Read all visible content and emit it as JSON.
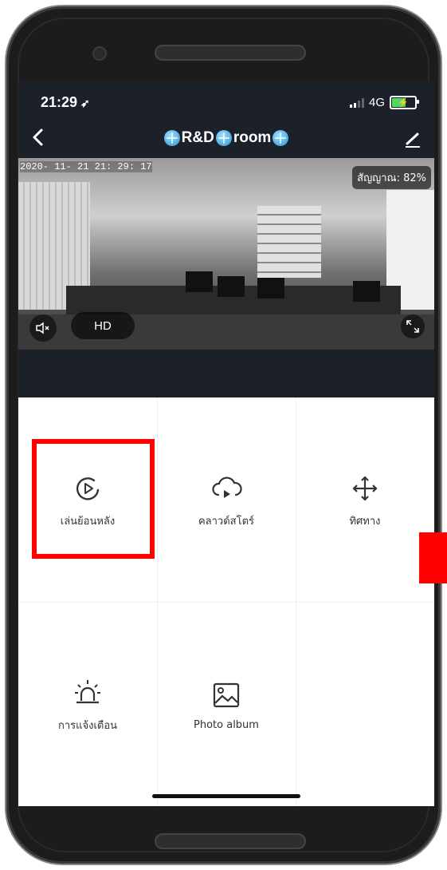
{
  "status_bar": {
    "time": "21:29",
    "network": "4G"
  },
  "header": {
    "title_part1": "R&D",
    "title_part2": "room"
  },
  "video": {
    "timestamp": "2020- 11- 21  21: 29: 17",
    "signal_text": "สัญญาณ: 82%",
    "quality_label": "HD"
  },
  "features": [
    {
      "label": "เล่นย้อนหลัง",
      "icon": "playback-icon"
    },
    {
      "label": "คลาวด์สโตร์",
      "icon": "cloud-store-icon"
    },
    {
      "label": "ทิศทาง",
      "icon": "direction-icon"
    },
    {
      "label": "การแจ้งเตือน",
      "icon": "alarm-icon"
    },
    {
      "label": "Photo album",
      "icon": "photo-album-icon"
    }
  ],
  "colors": {
    "header_bg": "#1b2029",
    "highlight": "#ff0000",
    "battery": "#4cd964"
  }
}
